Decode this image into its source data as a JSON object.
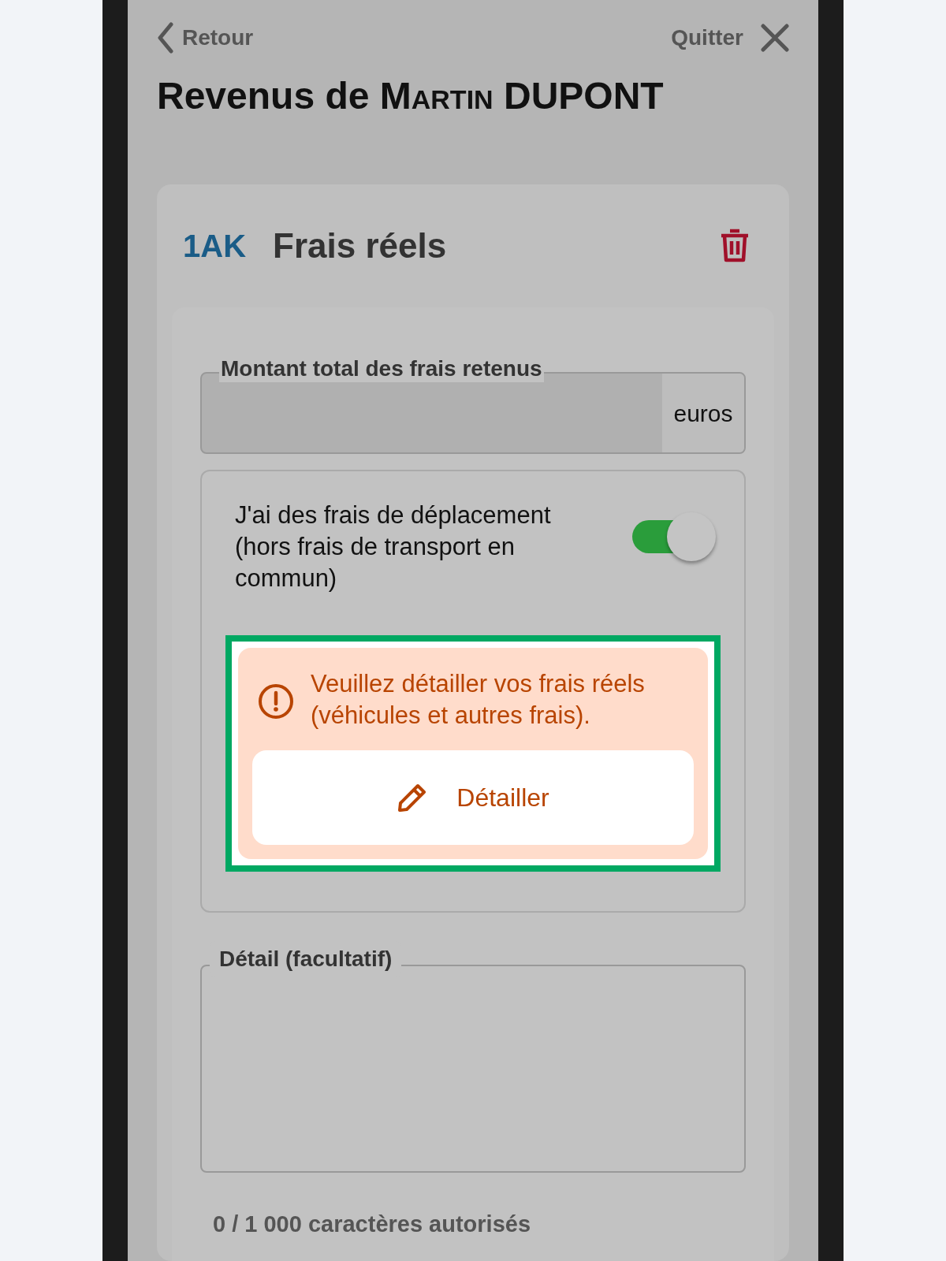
{
  "nav": {
    "back": "Retour",
    "quit": "Quitter"
  },
  "title": {
    "prefix": "Revenus de",
    "first_name": "Martin",
    "last_name": "DUPONT"
  },
  "card": {
    "code": "1AK",
    "heading": "Frais réels",
    "amount_field": {
      "label": "Montant total des frais retenus",
      "unit": "euros"
    },
    "toggle": {
      "label": "J'ai des frais de déplacement (hors frais de transport en commun)",
      "on": true
    },
    "alert": {
      "message": "Veuillez détailler vos frais réels (véhicules et autres frais).",
      "button": "Détailler",
      "highlighted": true
    },
    "detail_field": {
      "label": "Détail (facultatif)",
      "counter": "0 / 1 000 caractères autorisés"
    }
  }
}
